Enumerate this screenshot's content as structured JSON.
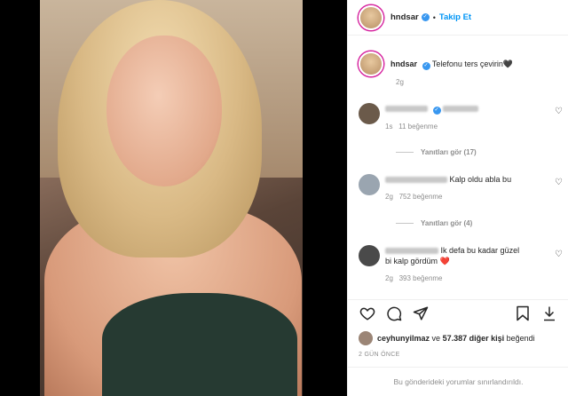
{
  "header": {
    "username": "hndsar",
    "separator": "•",
    "follow_label": "Takip Et"
  },
  "caption": {
    "username": "hndsar",
    "text": "Telefonu ters çevirin",
    "emoji": "🖤",
    "time": "2g"
  },
  "comments": [
    {
      "text": "",
      "time": "1s",
      "likes": "11 beğenme",
      "replies": "Yanıtları gör (17)"
    },
    {
      "text": "Kalp oldu abla bu",
      "time": "2g",
      "likes": "752 beğenme",
      "replies": "Yanıtları gör (4)"
    },
    {
      "text": "Ik defa bu kadar güzel bi kalp gördüm",
      "emoji": "❤️",
      "time": "2g",
      "likes": "393 beğenme"
    }
  ],
  "likes": {
    "user": "ceyhunyilmaz",
    "conjunction": "ve",
    "others": "57.387 diğer kişi",
    "suffix": "beğendi"
  },
  "posted_ago": "2 GÜN ÖNCE",
  "comments_limited": "Bu gönderideki yorumlar sınırlandırıldı.",
  "colors": {
    "accent": "#0095f6",
    "verified": "#3897f0",
    "heart": "#ed4956",
    "muted": "#8e8e8e"
  },
  "icons": [
    "verified-badge-icon",
    "heart-icon",
    "comment-icon",
    "share-icon",
    "bookmark-icon",
    "download-icon"
  ]
}
